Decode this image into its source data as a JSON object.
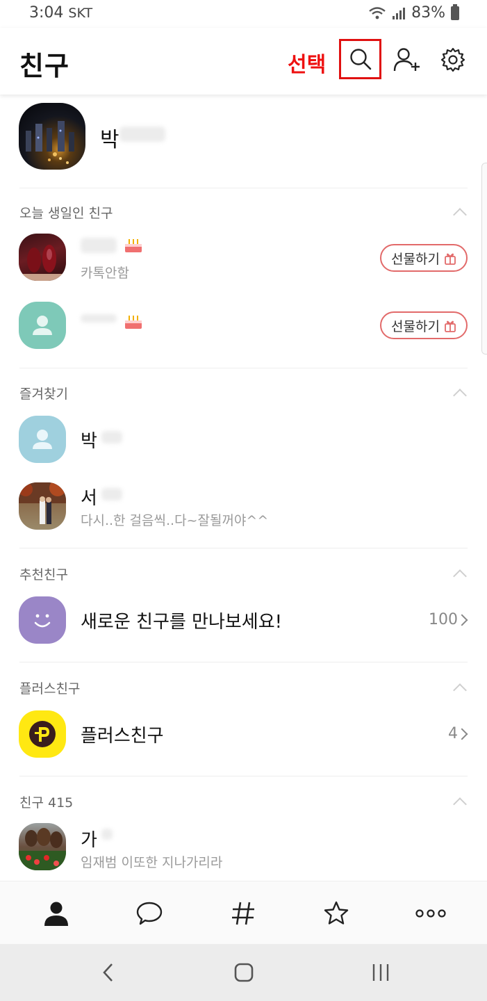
{
  "status": {
    "time": "3:04",
    "carrier": "SKT",
    "battery": "83%"
  },
  "header": {
    "title": "친구",
    "select_label": "선택"
  },
  "profile": {
    "name": "박"
  },
  "birthday": {
    "title": "오늘 생일인 친구",
    "friends": [
      {
        "status": "카톡안함",
        "gift_label": "선물하기"
      },
      {
        "gift_label": "선물하기"
      }
    ]
  },
  "favorites": {
    "title": "즐겨찾기",
    "items": [
      {
        "name": "박"
      },
      {
        "name": "서",
        "status": "다시..한 걸음씩..다~잘될꺼야^^"
      }
    ]
  },
  "recommended": {
    "title": "추천친구",
    "label": "새로운 친구를 만나보세요!",
    "count": "100"
  },
  "plus": {
    "title": "플러스친구",
    "label": "플러스친구",
    "count": "4"
  },
  "friends": {
    "title": "친구 415",
    "items": [
      {
        "name": "가",
        "status": "임재범  이또한 지나가리라"
      }
    ]
  },
  "tabs": [
    "friends-icon",
    "chat-icon",
    "hashtag-icon",
    "star-icon",
    "more-icon"
  ],
  "colors": {
    "annotation": "#ee1111",
    "gift": "#e26a6a",
    "plus_yellow": "#ffe812",
    "recommend_purple": "#9a86c7",
    "default_avatar_teal": "#7ec9b8",
    "default_avatar_blue": "#9fd0de"
  }
}
